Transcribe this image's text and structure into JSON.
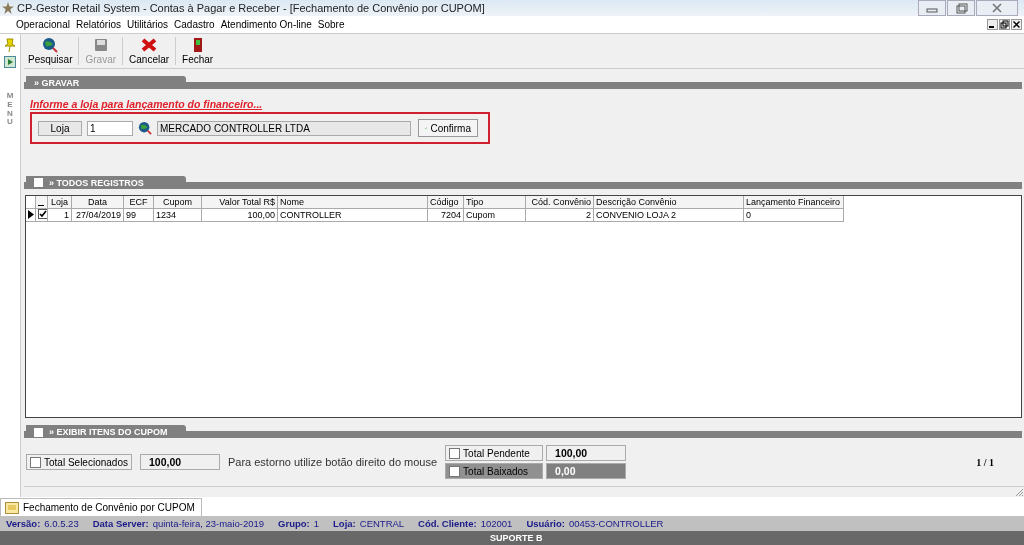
{
  "window": {
    "title": "CP-Gestor Retail System - Contas à Pagar e Receber - [Fechamento de Convênio por CUPOM]"
  },
  "menu": [
    "Operacional",
    "Relatórios",
    "Utilitários",
    "Cadastro",
    "Atendimento On-line",
    "Sobre"
  ],
  "sidebar": {
    "label": "MENU"
  },
  "toolbar": [
    {
      "label": "Pesquisar",
      "kind": "search",
      "disabled": false
    },
    {
      "label": "Gravar",
      "kind": "save",
      "disabled": true
    },
    {
      "label": "Cancelar",
      "kind": "cancel",
      "disabled": false
    },
    {
      "label": "Fechar",
      "kind": "exit",
      "disabled": false
    }
  ],
  "gravar": {
    "title": "» GRAVAR",
    "message": "Informe a loja para lançamento do financeiro...",
    "loja_button": "Loja",
    "loja_value": "1",
    "store_name": "MERCADO CONTROLLER LTDA",
    "confirm": "Confirma"
  },
  "registros": {
    "title": "» TODOS REGISTROS",
    "checked": false,
    "columns": [
      "Loja",
      "Data",
      "ECF",
      "Cupom",
      "Valor Total R$",
      "Nome",
      "Código",
      "Tipo",
      "Cód. Convênio",
      "Descrição Convênio",
      "Lançamento Financeiro"
    ],
    "rows": [
      {
        "selected": true,
        "checked": true,
        "cells": [
          "1",
          "27/04/2019",
          "99",
          "1234",
          "100,00",
          "CONTROLLER",
          "7204",
          "Cupom",
          "2",
          "CONVENIO LOJA 2",
          "0"
        ]
      }
    ]
  },
  "itens": {
    "title": "» EXIBIR ITENS DO CUPOM",
    "checked": false
  },
  "totals": {
    "selecionados": {
      "label": "Total Selecionados",
      "checked": false,
      "value": "100,00"
    },
    "hint": "Para estorno utilize botão direito do mouse",
    "others": [
      {
        "label": "Total Pendente",
        "checked": false,
        "value": "100,00",
        "kind": "pending"
      },
      {
        "label": "Total Baixados",
        "checked": false,
        "value": "0,00",
        "kind": "settled"
      }
    ],
    "page": "1 / 1"
  },
  "document_tab": {
    "label": "Fechamento de Convênio por CUPOM"
  },
  "status_bar": [
    {
      "label": "Versão:",
      "value": "6.0.5.23"
    },
    {
      "label": "Data Server:",
      "value": "quinta-feira, 23-maio-2019"
    },
    {
      "label": "Grupo:",
      "value": "1"
    },
    {
      "label": "Loja:",
      "value": "CENTRAL"
    },
    {
      "label": "Cód. Cliente:",
      "value": "102001"
    },
    {
      "label": "Usuário:",
      "value": "00453-CONTROLLER"
    }
  ],
  "footer": "SUPORTE B"
}
